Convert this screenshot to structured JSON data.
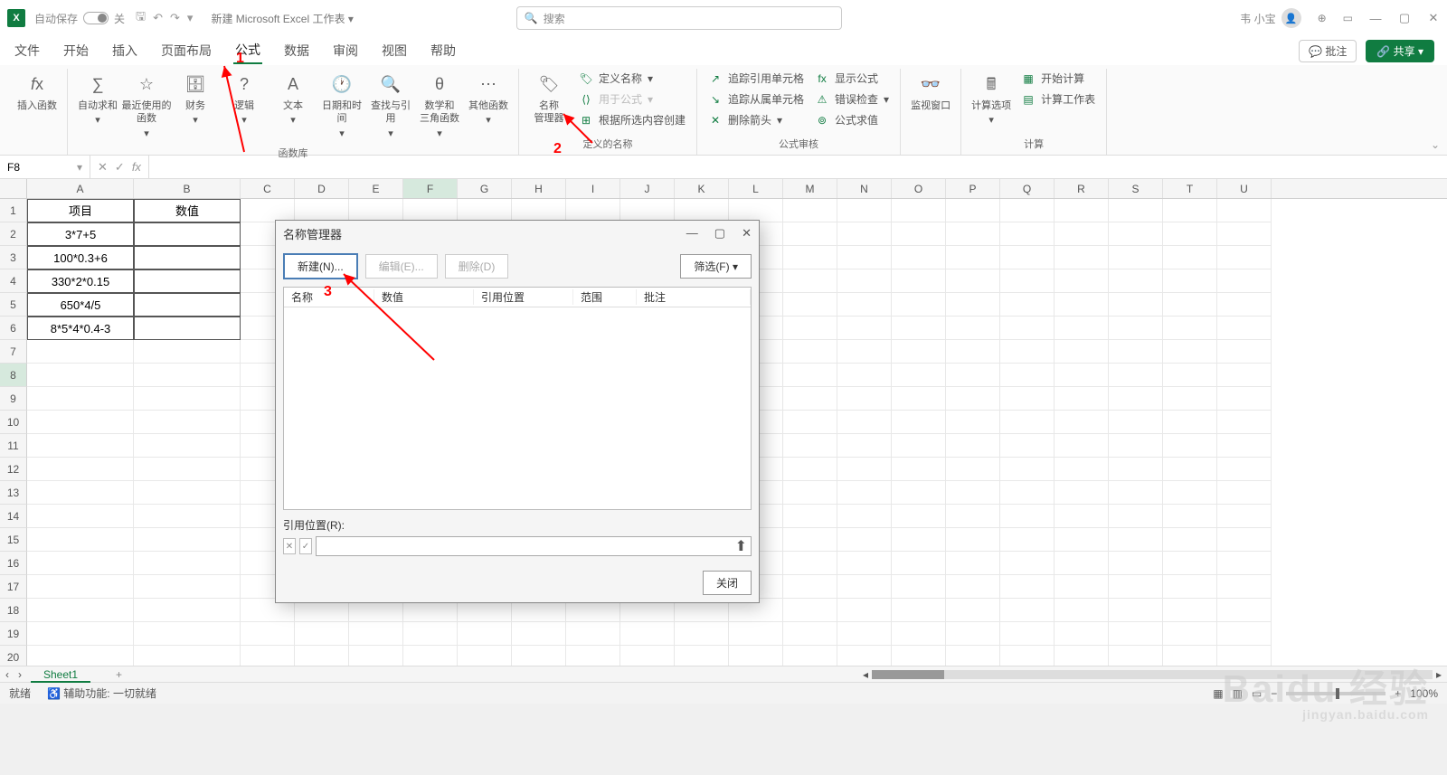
{
  "titlebar": {
    "autosave": "自动保存",
    "off": "关",
    "docname": "新建 Microsoft Excel 工作表",
    "search_placeholder": "搜索",
    "user": "韦 小宝"
  },
  "tabs": {
    "file": "文件",
    "home": "开始",
    "insert": "插入",
    "layout": "页面布局",
    "formulas": "公式",
    "data": "数据",
    "review": "审阅",
    "view": "视图",
    "help": "帮助",
    "comment": "批注",
    "share": "共享"
  },
  "ribbon": {
    "insert_fn": "插入函数",
    "autosum": "自动求和",
    "recent": "最近使用的\n函数",
    "financial": "财务",
    "logical": "逻辑",
    "text": "文本",
    "datetime": "日期和时间",
    "lookup": "查找与引用",
    "math": "数学和\n三角函数",
    "more": "其他函数",
    "lib_label": "函数库",
    "name_mgr": "名称\n管理器",
    "def_name": "定义名称",
    "use_formula": "用于公式",
    "from_sel": "根据所选内容创建",
    "names_label": "定义的名称",
    "trace_prec": "追踪引用单元格",
    "trace_dep": "追踪从属单元格",
    "remove_arrows": "删除箭头",
    "show_formulas": "显示公式",
    "error_check": "错误检查",
    "eval_formula": "公式求值",
    "audit_label": "公式审核",
    "watch": "监视窗口",
    "calc_opts": "计算选项",
    "calc_now": "开始计算",
    "calc_sheet": "计算工作表",
    "calc_label": "计算"
  },
  "fbar": {
    "namebox": "F8",
    "fx": "fx"
  },
  "columns": [
    "A",
    "B",
    "C",
    "D",
    "E",
    "F",
    "G",
    "H",
    "I",
    "J",
    "K",
    "L",
    "M",
    "N",
    "O",
    "P",
    "Q",
    "R",
    "S",
    "T",
    "U"
  ],
  "sheet": {
    "header": [
      "项目",
      "数值"
    ],
    "rows": [
      "3*7+5",
      "100*0.3+6",
      "330*2*0.15",
      "650*4/5",
      "8*5*4*0.4-3"
    ]
  },
  "sheettab": "Sheet1",
  "status": {
    "ready": "就绪",
    "acc": "辅助功能: 一切就绪",
    "zoom": "100%"
  },
  "dialog": {
    "title": "名称管理器",
    "new": "新建(N)...",
    "edit": "编辑(E)...",
    "delete": "删除(D)",
    "filter": "筛选(F)",
    "col_name": "名称",
    "col_value": "数值",
    "col_ref": "引用位置",
    "col_scope": "范围",
    "col_comment": "批注",
    "ref_label": "引用位置(R):",
    "close": "关闭"
  },
  "anno": {
    "one": "1",
    "two": "2",
    "three": "3"
  },
  "watermark": {
    "brand": "Baidu 经验",
    "url": "jingyan.baidu.com"
  }
}
